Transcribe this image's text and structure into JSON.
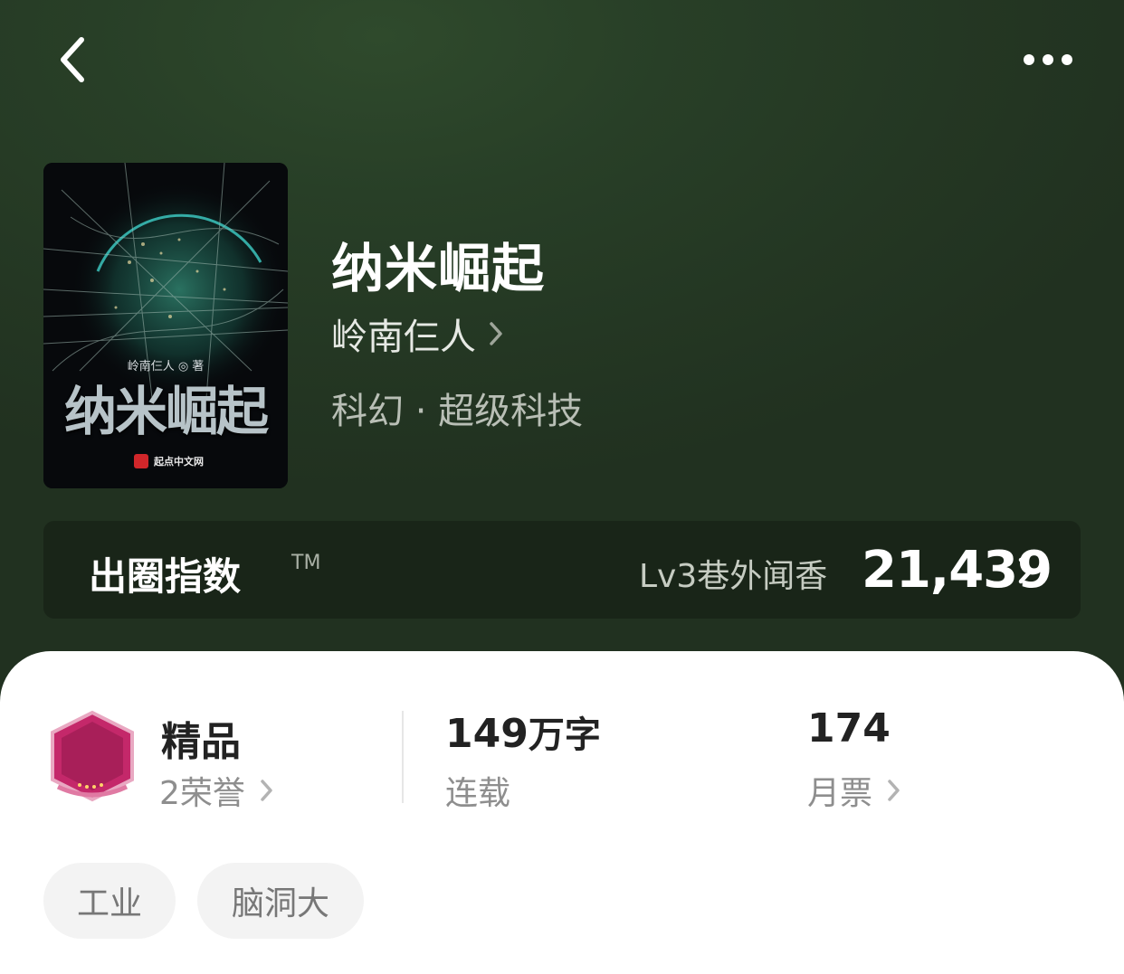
{
  "nav": {
    "back_icon": "chevron-left-icon",
    "more_icon": "more-dots-icon"
  },
  "book": {
    "title": "纳米崛起",
    "author": "岭南仨人",
    "genre": "科幻 · 超级科技",
    "cover": {
      "title": "纳米崛起",
      "author_line": "岭南仨人 ◎ 著",
      "publisher": "起点中文网"
    }
  },
  "circle_index": {
    "label": "出圈指数",
    "tm": "TM",
    "level": "Lv3巷外闻香",
    "value": "21,439"
  },
  "stats": {
    "quality": {
      "title": "精品",
      "sub": "2荣誉"
    },
    "words": {
      "number": "149",
      "unit": "万字",
      "sub": "连载"
    },
    "tickets": {
      "number": "174",
      "sub": "月票"
    }
  },
  "tags": [
    "工业",
    "脑洞大"
  ],
  "colors": {
    "background": "#263b25",
    "sheet": "#ffffff",
    "badge": "#c4286a"
  }
}
